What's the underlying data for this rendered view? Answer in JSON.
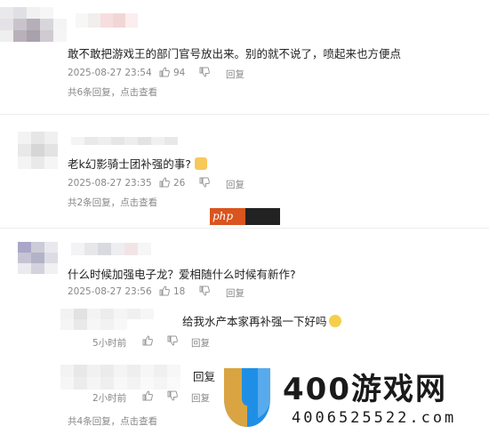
{
  "comments": [
    {
      "text": "敢不敢把游戏王的部门官号放出来。别的就不说了，喷起来也方便点",
      "date": "2025-08-27 23:54",
      "likes": "94",
      "reply_label": "回复",
      "thread_summary": "共6条回复，点击查看"
    },
    {
      "text": "老k幻影骑士团补强的事?",
      "date": "2025-08-27 23:35",
      "likes": "26",
      "reply_label": "回复",
      "thread_summary": "共2条回复，点击查看"
    },
    {
      "text": "什么时候加强电子龙？爱相随什么时候有新作?",
      "date": "2025-08-27 23:56",
      "likes": "18",
      "reply_label": "回复",
      "thread_summary": "共4条回复，点击查看",
      "replies": [
        {
          "text": "给我水产本家再补强一下好吗",
          "time": "5小时前",
          "reply_label": "回复"
        },
        {
          "text": "回复",
          "time": "2小时前",
          "reply_label": "回复"
        }
      ]
    }
  ],
  "watermark": {
    "php_label": "php",
    "site_name": "400游戏网",
    "phone": "4006525522.com"
  },
  "colors": {
    "brand_blue": "#1f8fe6",
    "brand_gold": "#d9a441"
  }
}
